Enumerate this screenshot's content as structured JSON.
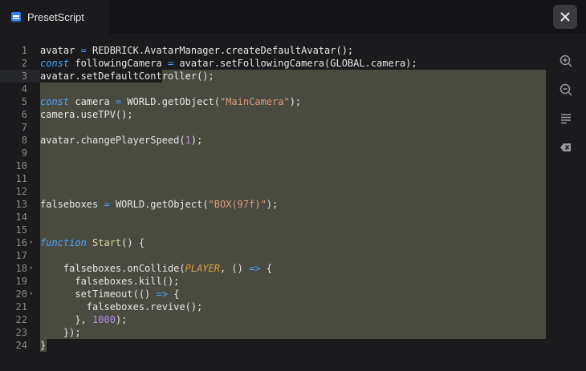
{
  "tab": {
    "title": "PresetScript",
    "icon": "script-file-icon"
  },
  "toolbar": {
    "close_icon": "close-icon"
  },
  "side_tools": [
    "zoom-in-icon",
    "zoom-out-icon",
    "format-icon",
    "clear-icon"
  ],
  "code_lines": [
    {
      "n": "1",
      "html": "avatar = REDBRICK.AvatarManager.createDefaultAvatar();"
    },
    {
      "n": "2",
      "html": "const followingCamera = avatar.setFollowingCamera(GLOBAL.camera);"
    },
    {
      "n": "3",
      "html": "avatar.setDefaultController();"
    },
    {
      "n": "4",
      "html": ""
    },
    {
      "n": "5",
      "html": "const camera = WORLD.getObject(\"MainCamera\");"
    },
    {
      "n": "6",
      "html": "camera.useTPV();"
    },
    {
      "n": "7",
      "html": ""
    },
    {
      "n": "8",
      "html": "avatar.changePlayerSpeed(1);"
    },
    {
      "n": "9",
      "html": ""
    },
    {
      "n": "10",
      "html": ""
    },
    {
      "n": "11",
      "html": ""
    },
    {
      "n": "12",
      "html": ""
    },
    {
      "n": "13",
      "html": "falseboxes = WORLD.getObject(\"BOX(97f)\");"
    },
    {
      "n": "14",
      "html": ""
    },
    {
      "n": "15",
      "html": ""
    },
    {
      "n": "16",
      "html": "function Start() {"
    },
    {
      "n": "17",
      "html": ""
    },
    {
      "n": "18",
      "html": "    falseboxes.onCollide(PLAYER, () => {"
    },
    {
      "n": "19",
      "html": "      falseboxes.kill();"
    },
    {
      "n": "20",
      "html": "      setTimeout(() => {"
    },
    {
      "n": "21",
      "html": "        falseboxes.revive();"
    },
    {
      "n": "22",
      "html": "      }, 1000);"
    },
    {
      "n": "23",
      "html": "    });"
    },
    {
      "n": "24",
      "html": "}"
    }
  ]
}
